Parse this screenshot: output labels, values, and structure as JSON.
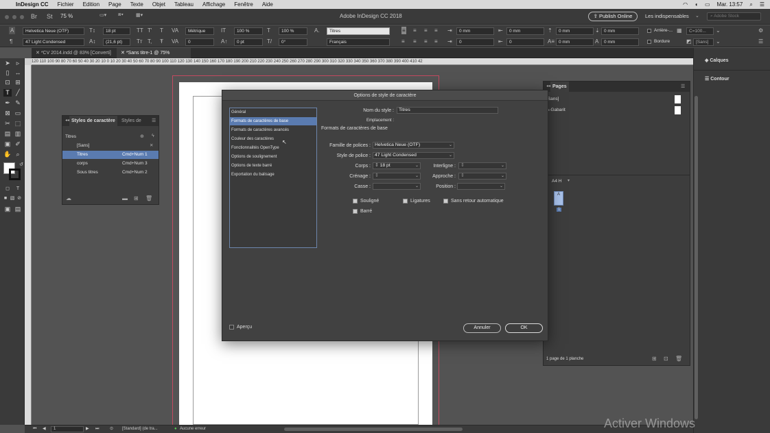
{
  "menubar": {
    "app": "InDesign CC",
    "items": [
      "Fichier",
      "Edition",
      "Page",
      "Texte",
      "Objet",
      "Tableau",
      "Affichage",
      "Fenêtre",
      "Aide"
    ],
    "clock": "Mar. 13:57"
  },
  "titlebar": {
    "title": "Adobe InDesign CC 2018",
    "zoom": "75 %",
    "publish_label": "Publish Online",
    "workspace": "Les indispensables",
    "search_placeholder": "Adobe Stock"
  },
  "control": {
    "font": "Helvetica Neue (OTF)",
    "style": "47 Light Condensed",
    "size": "18 pt",
    "leading": "(21,6 pt)",
    "kerning": "Métrique",
    "tracking": "0",
    "vscale": "100 %",
    "hscale": "100 %",
    "baseline": "0 pt",
    "skew": "0°",
    "char_style": "Titres",
    "language": "Français",
    "spacing_values": [
      "0 mm",
      "0 mm",
      "0 mm",
      "0 mm",
      "0",
      "0",
      "0 mm",
      "0 mm"
    ],
    "arriere_label": "Arrière-...",
    "color_value": "C=100...",
    "bordure_label": "Bordure",
    "none_label": "[Sans]"
  },
  "tabs": [
    {
      "label": "*CV 2014.indd @ 83% [Converti]"
    },
    {
      "label": "*Sans titre-1 @ 75%"
    }
  ],
  "ruler_text": "120  110  100  90  80  70  60  50  40  30  20  10  0  10  20  30  40  50  60  70  80  90  100  110  120  130  140  150  160  170  180  190  200  210  220  230  240  250  260  270  280  290  300  310  320  330  340  350  360  370  380  390  400  410  42",
  "char_styles_panel": {
    "tab1": "Styles de caractère",
    "tab2": "Styles de",
    "current": "Titres",
    "rows": [
      {
        "name": "[Sans]",
        "shortcut": ""
      },
      {
        "name": "Titres",
        "shortcut": "Cmd+Num 1"
      },
      {
        "name": "corps",
        "shortcut": "Cmd+Num 3"
      },
      {
        "name": "Sous titres",
        "shortcut": "Cmd+Num 2"
      }
    ]
  },
  "pages_panel": {
    "title": "Pages",
    "items": [
      "[Sans]",
      "A-Gabarit"
    ],
    "master_label": "A4 H",
    "page_letter": "A",
    "page_number": "1",
    "footer": "1 page de 1 planche"
  },
  "right_panels": [
    "Calques",
    "Contour"
  ],
  "dialog": {
    "title": "Options de style de caractère",
    "categories": [
      "Général",
      "Formats de caractères de base",
      "Formats de caractères avancés",
      "Couleur des caractères",
      "Fonctionnalités OpenType",
      "Options de soulignement",
      "Options de texte barré",
      "Exportation du balisage"
    ],
    "style_name_label": "Nom du style :",
    "style_name": "Titres",
    "location_label": "Emplacement :",
    "section_title": "Formats de caractères de base",
    "font_family_label": "Famille de polices :",
    "font_family": "Helvetica Neue (OTF)",
    "font_style_label": "Style de police :",
    "font_style": "47 Light Condensed",
    "size_label": "Corps :",
    "size": "18 pt",
    "leading_label": "Interligne :",
    "kerning_label": "Crénage :",
    "tracking_label": "Approche :",
    "case_label": "Casse :",
    "position_label": "Position :",
    "underline_label": "Souligné",
    "ligatures_label": "Ligatures",
    "nobreak_label": "Sans retour automatique",
    "strike_label": "Barré",
    "preview_label": "Aperçu",
    "cancel_label": "Annuler",
    "ok_label": "OK"
  },
  "statusbar": {
    "page": "1",
    "profile": "[Standard] (de tra...",
    "errors": "Aucune erreur"
  },
  "watermark": "Activer Windows"
}
